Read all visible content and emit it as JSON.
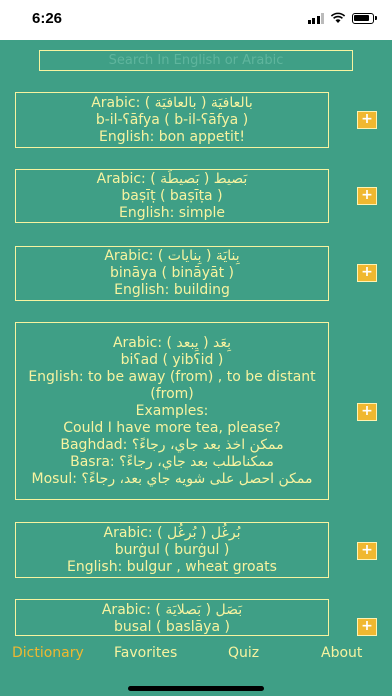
{
  "status": {
    "time": "6:26"
  },
  "search": {
    "placeholder": "Search In English or Arabic"
  },
  "entries": [
    {
      "lines": [
        "Arabic: (  بالعافيَة  )   بالعافيَة",
        "b-il-ʕāfya ( b-il-ʕāfya )",
        "English: bon appetit!"
      ],
      "add": "+"
    },
    {
      "lines": [
        "Arabic: (  بَصيطَة  )   بَصيط",
        "baṣīṭ ( baṣīṭa )",
        "English: simple"
      ],
      "add": "+"
    },
    {
      "lines": [
        "Arabic: (  بِنايات  )   بِنايَة",
        "bināya ( bināyāt )",
        "English: building"
      ],
      "add": "+"
    },
    {
      "lines": [
        "Arabic: (  يِبعد  )   بِعَد",
        "biʕad ( yibʕid )",
        "English: to be away (from) ,  to be distant (from)",
        "Examples:",
        "Could I have more tea, please?",
        "Baghdad:  ممكن اخذ بعد جاي، رجاءً؟",
        "Basra:  ممكناطلب بعد جاي، رجاءً؟",
        "Mosul:  ممكن احصل على شويه جاي بعد، رجاءً؟"
      ],
      "add": "+"
    },
    {
      "lines": [
        "Arabic: (  بُرغُل  )   بُرغُل",
        "burġul ( burġul )",
        "English: bulgur ,  wheat groats"
      ],
      "add": "+"
    },
    {
      "lines": [
        "Arabic: (  بَصلايَة  )   بَصَل",
        "busal ( baslāya )"
      ],
      "add": "+"
    }
  ],
  "tabs": [
    "Dictionary",
    "Favorites",
    "Quiz",
    "About"
  ],
  "colors": {
    "background": "#3f9f86",
    "text": "#f7f3a0",
    "accent": "#f0b830"
  }
}
